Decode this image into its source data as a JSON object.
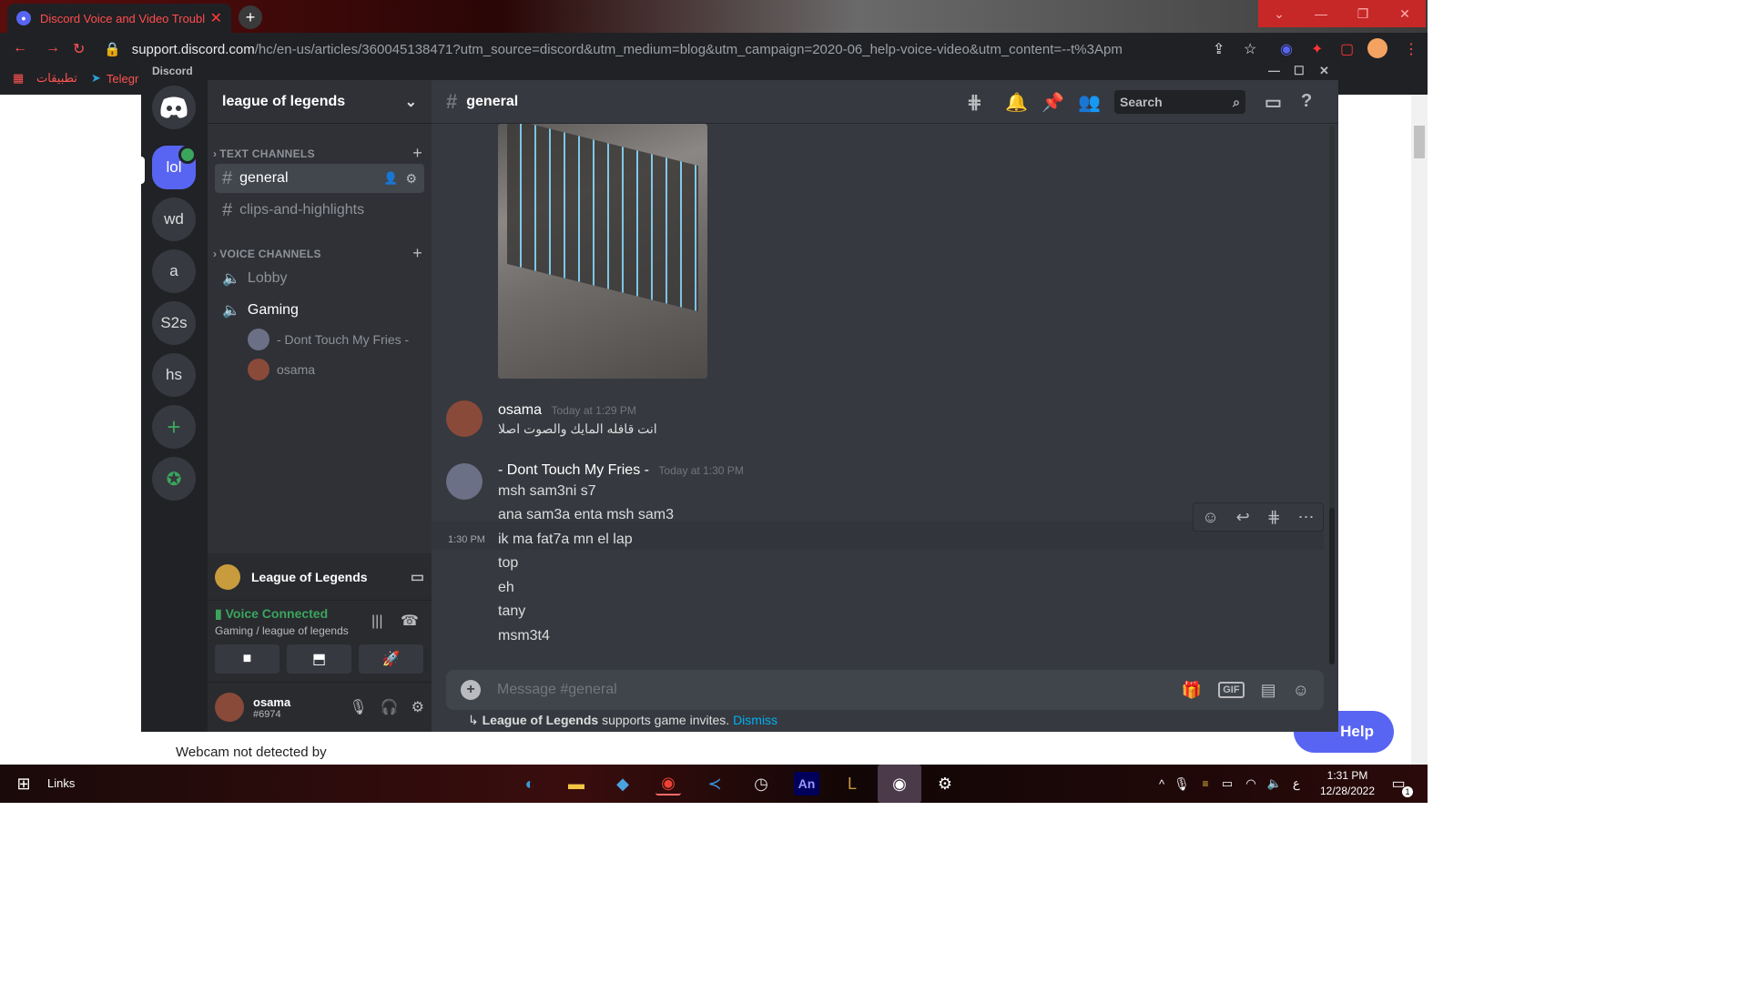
{
  "browser": {
    "tab_title": "Discord Voice and Video Troubles",
    "tab_close": "✕",
    "new_tab": "+",
    "url_host": "support.discord.com",
    "url_path": "/hc/en-us/articles/360045138471?utm_source=discord&utm_medium=blog&utm_campaign=2020-06_help-voice-video&utm_content=--t%3Apm",
    "bookmarks": [
      "تطبيقات",
      "Telegr"
    ]
  },
  "page": {
    "text": "Webcam not detected by",
    "help_button": "Help"
  },
  "discord": {
    "window_title": "Discord",
    "guilds": [
      "lol",
      "wd",
      "a",
      "S2s",
      "hs"
    ],
    "server_name": "league of legends",
    "categories": {
      "text": "TEXT CHANNELS",
      "voice": "VOICE CHANNELS"
    },
    "text_channels": [
      "general",
      "clips-and-highlights"
    ],
    "voice_channels": [
      "Lobby",
      "Gaming"
    ],
    "voice_users": [
      "- Dont Touch My Fries -",
      "osama"
    ],
    "activity": "League of Legends",
    "voice_status": "Voice Connected",
    "voice_location": "Gaming / league of legends",
    "user": {
      "name": "osama",
      "tag": "#6974"
    },
    "channel_header": "general",
    "search_placeholder": "Search",
    "messages": [
      {
        "author": "osama",
        "time": "Today at 1:29 PM",
        "lines": [
          "انت قافله المايك والصوت اصلا"
        ]
      },
      {
        "author": "- Dont Touch My Fries -",
        "time": "Today at 1:30 PM",
        "lines": [
          "msh sam3ni s7",
          "ana sam3a enta msh sam3",
          "ik  ma fat7a mn el lap",
          "top",
          "eh",
          "tany",
          "msm3t4"
        ]
      }
    ],
    "hover_time": "1:30 PM",
    "composer_placeholder": "Message #general",
    "invite_game": "League of Legends",
    "invite_text": "supports game invites.",
    "invite_dismiss": "Dismiss"
  },
  "taskbar": {
    "links": "Links",
    "time": "1:31 PM",
    "date": "12/28/2022",
    "lang": "ع",
    "notif_count": "1"
  },
  "colors": {
    "blurple": "#5865f2",
    "green": "#3ba55d"
  }
}
